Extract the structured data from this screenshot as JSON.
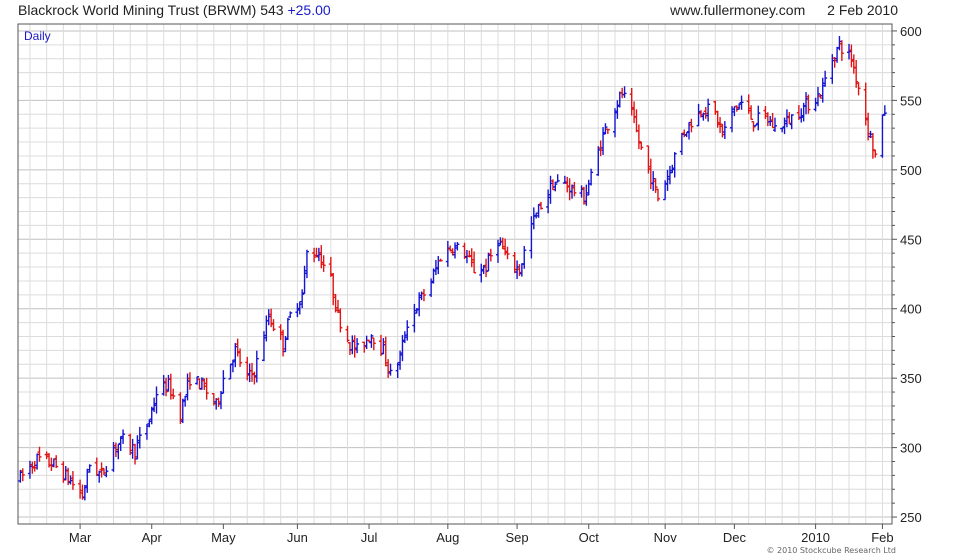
{
  "header": {
    "title": "Blackrock World Mining Trust (BRWM)",
    "last": "543",
    "change": "+25.00",
    "site": "www.fullermoney.com",
    "date": "2 Feb 2010"
  },
  "footer": {
    "copyright": "© 2010 Stockcube Research Ltd"
  },
  "colors": {
    "up": "#1414d2",
    "down": "#e01414",
    "grid": "#dcdcdc",
    "grid_major": "#c0c0c0",
    "frame": "#555555",
    "label": "#1a1acc"
  },
  "chart_data": {
    "type": "ohlc",
    "period_label": "Daily",
    "y_ticks": [
      250,
      300,
      350,
      400,
      450,
      500,
      550,
      600
    ],
    "ylim": [
      245,
      605
    ],
    "x_ticks": [
      "Mar",
      "Apr",
      "May",
      "Jun",
      "Jul",
      "Aug",
      "Sep",
      "Oct",
      "Nov",
      "Dec",
      "2010",
      "Feb"
    ],
    "x_tick_dates": [
      "2009-03-02",
      "2009-04-01",
      "2009-05-01",
      "2009-06-01",
      "2009-07-01",
      "2009-08-03",
      "2009-09-01",
      "2009-10-01",
      "2009-11-02",
      "2009-12-01",
      "2010-01-04",
      "2010-02-01"
    ],
    "xlim": [
      "2009-02-04",
      "2010-02-05"
    ],
    "series_points": [
      [
        "2009-02-05",
        278
      ],
      [
        "2009-02-12",
        292
      ],
      [
        "2009-02-19",
        288
      ],
      [
        "2009-02-26",
        276
      ],
      [
        "2009-03-03",
        265
      ],
      [
        "2009-03-06",
        288
      ],
      [
        "2009-03-11",
        280
      ],
      [
        "2009-03-16",
        300
      ],
      [
        "2009-03-20",
        305
      ],
      [
        "2009-03-25",
        298
      ],
      [
        "2009-03-31",
        320
      ],
      [
        "2009-04-03",
        340
      ],
      [
        "2009-04-08",
        345
      ],
      [
        "2009-04-13",
        325
      ],
      [
        "2009-04-17",
        350
      ],
      [
        "2009-04-22",
        345
      ],
      [
        "2009-04-28",
        330
      ],
      [
        "2009-05-01",
        350
      ],
      [
        "2009-05-06",
        370
      ],
      [
        "2009-05-11",
        350
      ],
      [
        "2009-05-14",
        355
      ],
      [
        "2009-05-20",
        395
      ],
      [
        "2009-05-26",
        375
      ],
      [
        "2009-05-29",
        395
      ],
      [
        "2009-06-03",
        410
      ],
      [
        "2009-06-05",
        440
      ],
      [
        "2009-06-10",
        440
      ],
      [
        "2009-06-15",
        420
      ],
      [
        "2009-06-18",
        395
      ],
      [
        "2009-06-23",
        375
      ],
      [
        "2009-06-26",
        370
      ],
      [
        "2009-07-02",
        382
      ],
      [
        "2009-07-07",
        370
      ],
      [
        "2009-07-10",
        352
      ],
      [
        "2009-07-14",
        365
      ],
      [
        "2009-07-17",
        390
      ],
      [
        "2009-07-22",
        405
      ],
      [
        "2009-07-27",
        420
      ],
      [
        "2009-07-31",
        438
      ],
      [
        "2009-08-05",
        445
      ],
      [
        "2009-08-10",
        440
      ],
      [
        "2009-08-14",
        428
      ],
      [
        "2009-08-19",
        430
      ],
      [
        "2009-08-24",
        450
      ],
      [
        "2009-08-28",
        435
      ],
      [
        "2009-09-02",
        428
      ],
      [
        "2009-09-07",
        460
      ],
      [
        "2009-09-11",
        475
      ],
      [
        "2009-09-16",
        490
      ],
      [
        "2009-09-21",
        490
      ],
      [
        "2009-09-25",
        485
      ],
      [
        "2009-09-29",
        480
      ],
      [
        "2009-10-02",
        495
      ],
      [
        "2009-10-07",
        525
      ],
      [
        "2009-10-12",
        545
      ],
      [
        "2009-10-15",
        555
      ],
      [
        "2009-10-19",
        540
      ],
      [
        "2009-10-22",
        520
      ],
      [
        "2009-10-27",
        495
      ],
      [
        "2009-10-30",
        480
      ],
      [
        "2009-11-04",
        500
      ],
      [
        "2009-11-09",
        525
      ],
      [
        "2009-11-13",
        535
      ],
      [
        "2009-11-18",
        545
      ],
      [
        "2009-11-23",
        540
      ],
      [
        "2009-11-26",
        525
      ],
      [
        "2009-12-01",
        545
      ],
      [
        "2009-12-04",
        548
      ],
      [
        "2009-12-09",
        535
      ],
      [
        "2009-12-14",
        538
      ],
      [
        "2009-12-18",
        530
      ],
      [
        "2009-12-23",
        535
      ],
      [
        "2009-12-30",
        545
      ],
      [
        "2010-01-06",
        555
      ],
      [
        "2010-01-11",
        580
      ],
      [
        "2010-01-14",
        590
      ],
      [
        "2010-01-19",
        580
      ],
      [
        "2010-01-22",
        560
      ],
      [
        "2010-01-26",
        530
      ],
      [
        "2010-01-29",
        510
      ],
      [
        "2010-02-02",
        543
      ]
    ]
  }
}
